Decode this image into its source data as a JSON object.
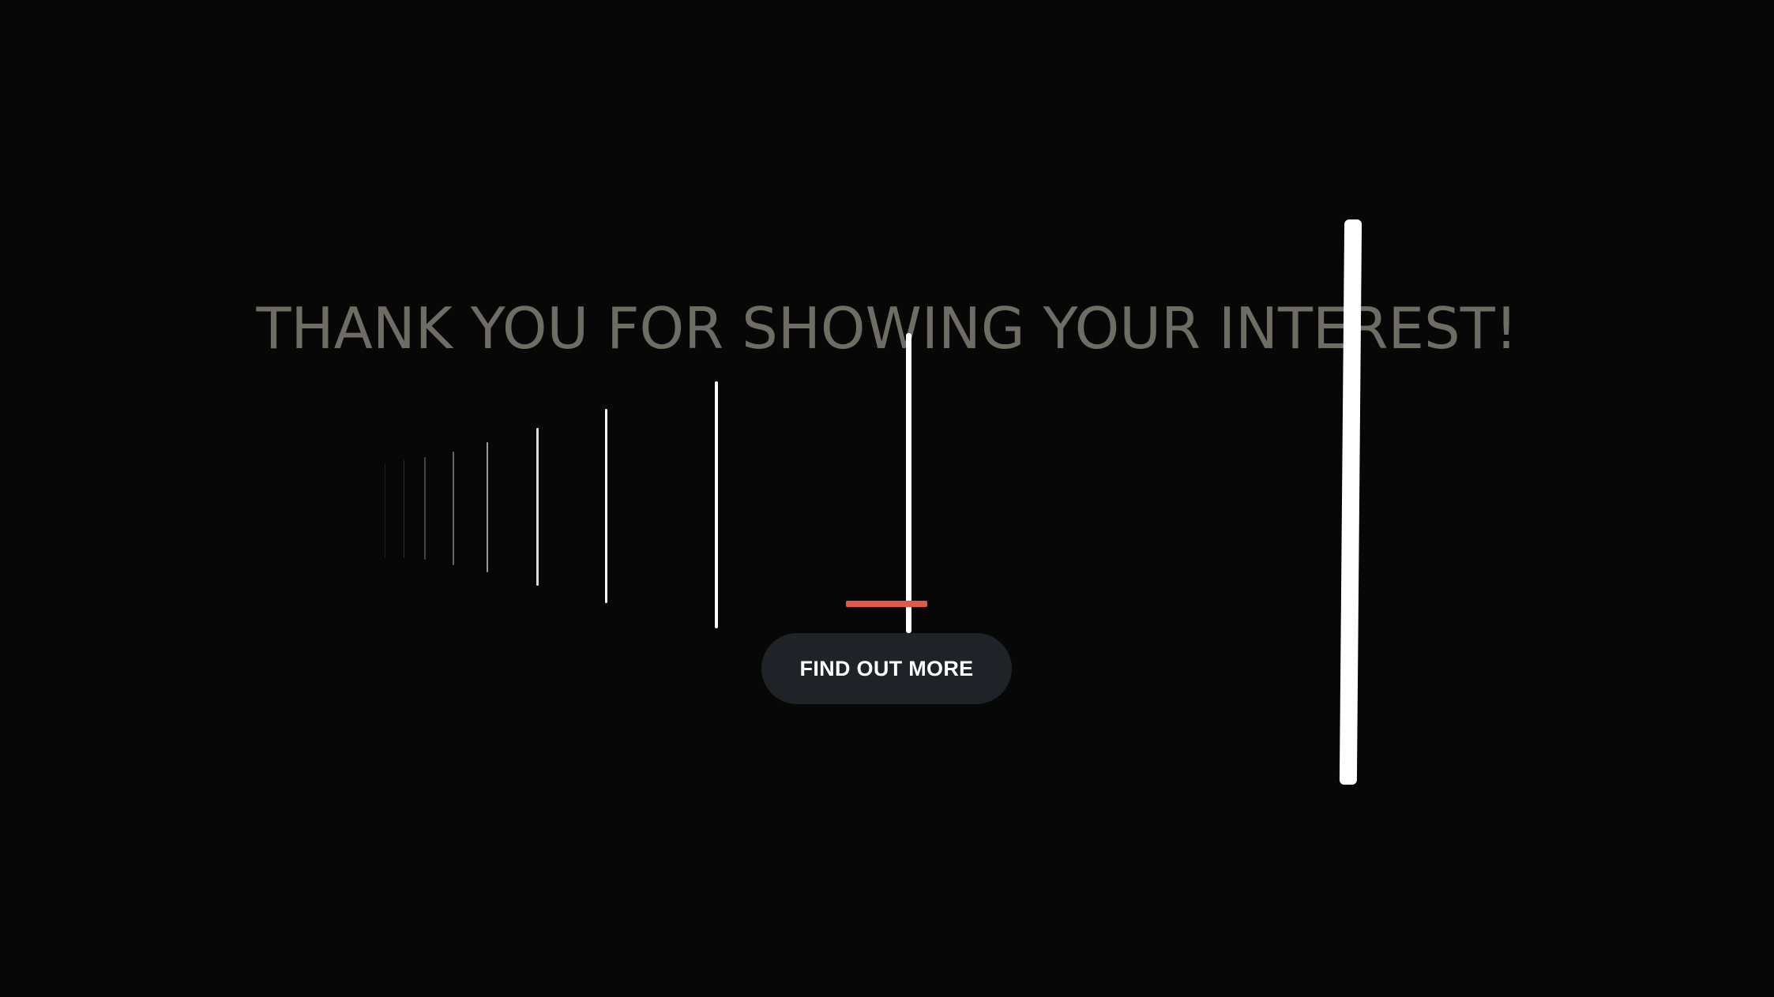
{
  "headline": "THANK YOU FOR SHOWING YOUR INTEREST!",
  "cta": {
    "label": "FIND OUT MORE"
  },
  "colors": {
    "background": "#070707",
    "headline": "#6f6c66",
    "accent": "#e05a4a",
    "button_bg": "#1f2226",
    "button_text": "#ffffff",
    "lines": "#ffffff"
  }
}
